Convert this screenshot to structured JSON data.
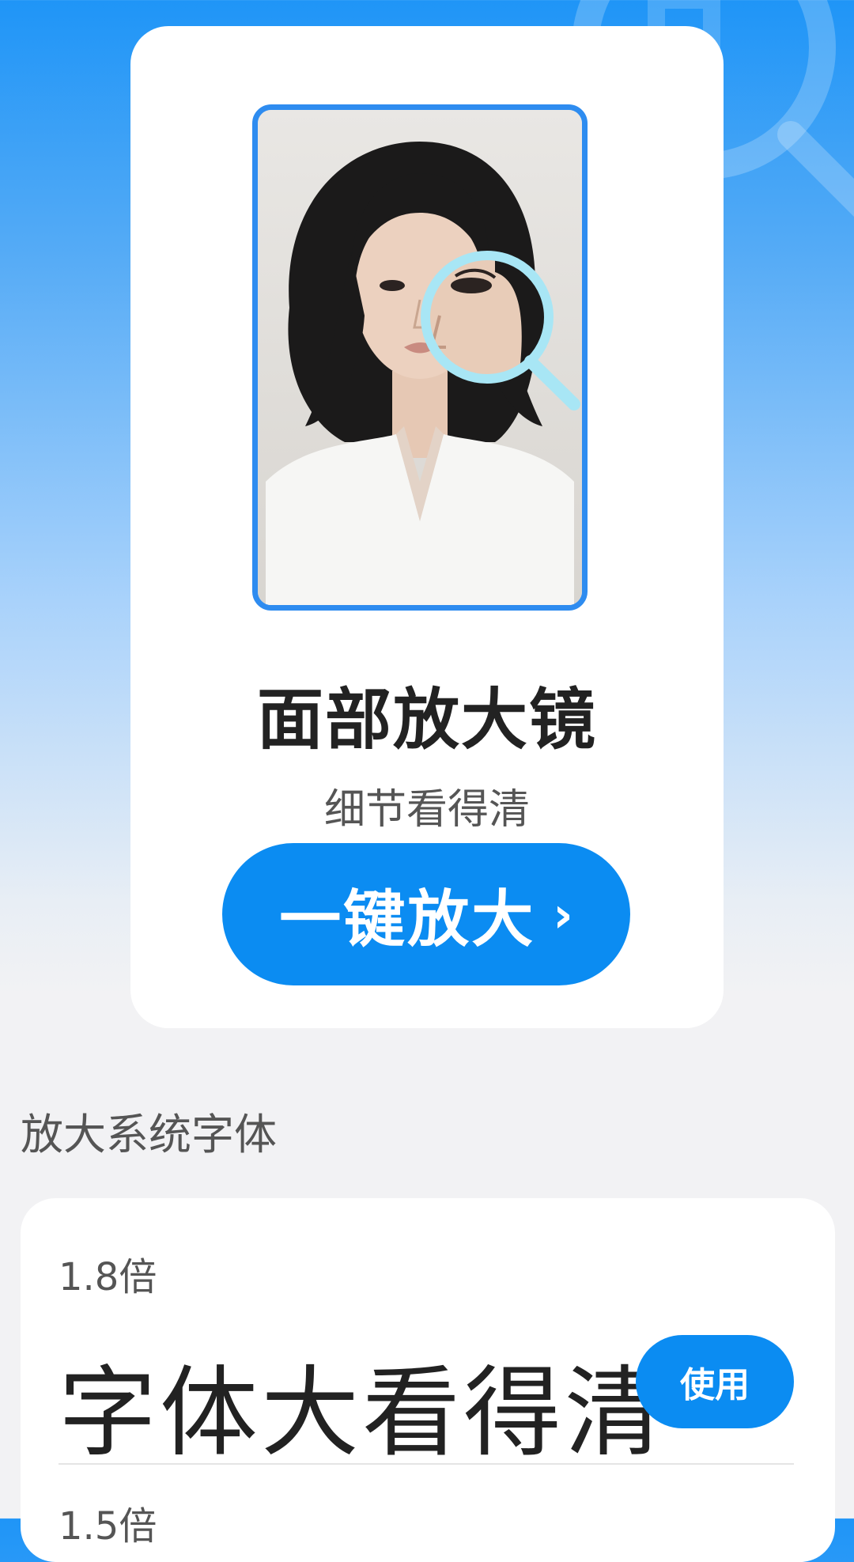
{
  "hero": {
    "title": "面部放大镜",
    "subtitle": "细节看得清",
    "cta_label": "一键放大",
    "cta_icon": "chevron-right-icon",
    "frame_color": "#2e8cf0",
    "button_color": "#0b8cf2"
  },
  "section": {
    "title": "放大系统字体"
  },
  "font_options": [
    {
      "scale": "1.8倍",
      "preview": "字体大看得清",
      "button_label": "使用"
    },
    {
      "scale": "1.5倍"
    }
  ]
}
